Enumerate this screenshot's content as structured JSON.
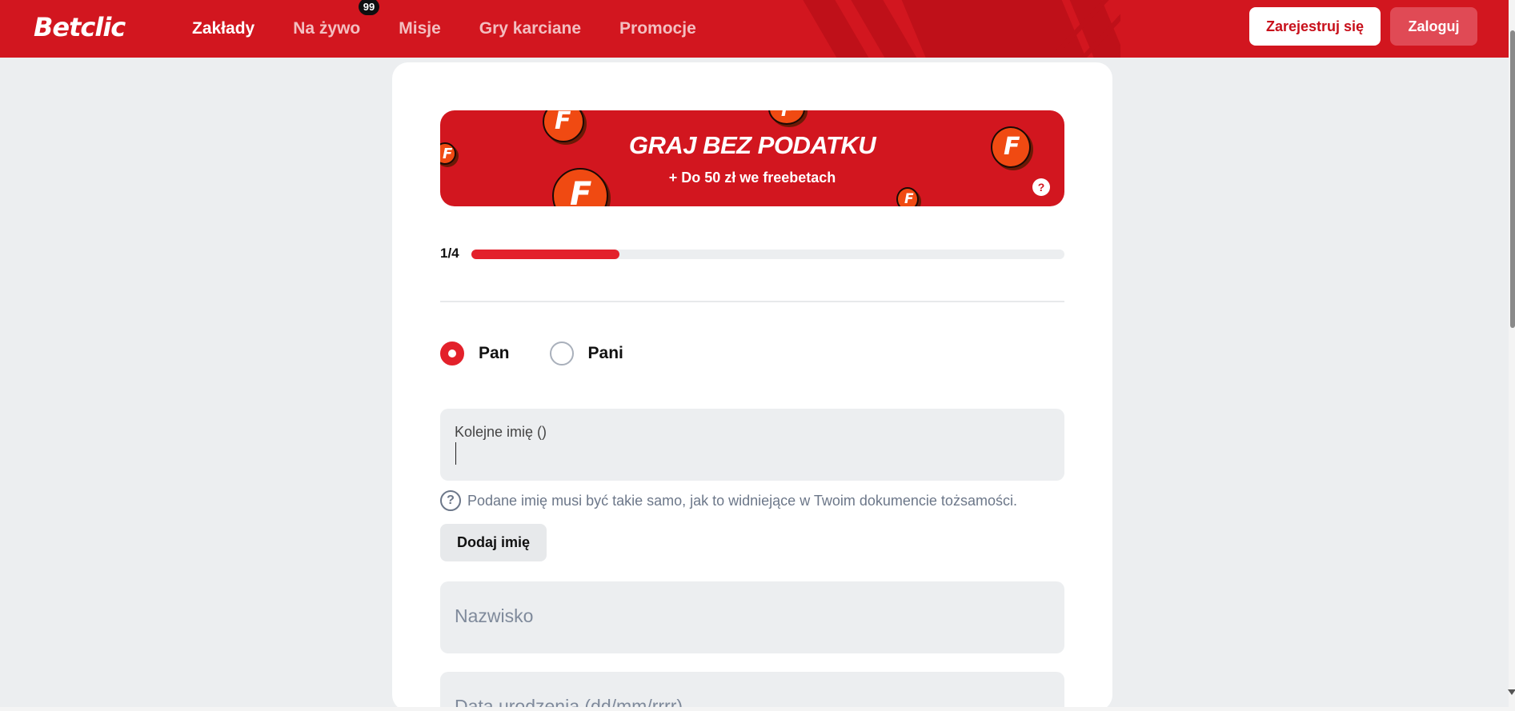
{
  "header": {
    "logo": "Betclic",
    "nav": [
      {
        "label": "Zakłady",
        "active": true
      },
      {
        "label": "Na żywo",
        "badge": "99"
      },
      {
        "label": "Misje"
      },
      {
        "label": "Gry karciane"
      },
      {
        "label": "Promocje"
      }
    ],
    "register_label": "Zarejestruj się",
    "login_label": "Zaloguj"
  },
  "promo": {
    "title": "GRAJ BEZ PODATKU",
    "subtitle": "+ Do 50 zł we freebetach",
    "help_label": "?",
    "coin_letter": "F"
  },
  "progress": {
    "step_label": "1/4",
    "value": 0.25
  },
  "gender": {
    "options": [
      {
        "label": "Pan",
        "checked": true
      },
      {
        "label": "Pani",
        "checked": false
      }
    ]
  },
  "form": {
    "next_name_label": "Kolejne imię ()",
    "hint_icon": "?",
    "hint_text": "Podane imię musi być takie samo, jak to widniejące w Twoim dokumencie tożsamości.",
    "add_name_label": "Dodaj imię",
    "surname_placeholder": "Nazwisko",
    "birthdate_placeholder": "Data urodzenia (dd/mm/rrrr)"
  },
  "colors": {
    "brand_red": "#d2161f",
    "accent_red": "#e3212b",
    "field_bg": "#eceef0"
  }
}
